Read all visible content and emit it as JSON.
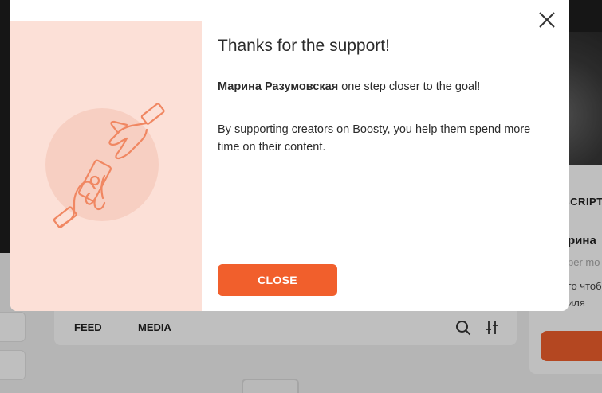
{
  "background": {
    "feed_tabs": [
      "FEED",
      "MEDIA"
    ],
    "side_panel": {
      "heading_fragment": "SCRIPT",
      "name_fragment": "рина",
      "sub_fragment": "per mo",
      "text_fragment_1": "го чтоб",
      "text_fragment_2": "иля"
    }
  },
  "modal": {
    "title": "Thanks for the support!",
    "creator_name": "Марина Разумовская",
    "goal_text": " one step closer to the goal!",
    "description": "By supporting creators on Boosty, you help them spend more time on their content.",
    "close_button": "CLOSE",
    "close_icon": "close-icon",
    "illustration": "hands-money-exchange-icon"
  },
  "colors": {
    "accent": "#f15f2c",
    "illustration_bg": "#fce0d7",
    "illustration_circle": "#f7cfc2",
    "illustration_stroke": "#f08762"
  }
}
